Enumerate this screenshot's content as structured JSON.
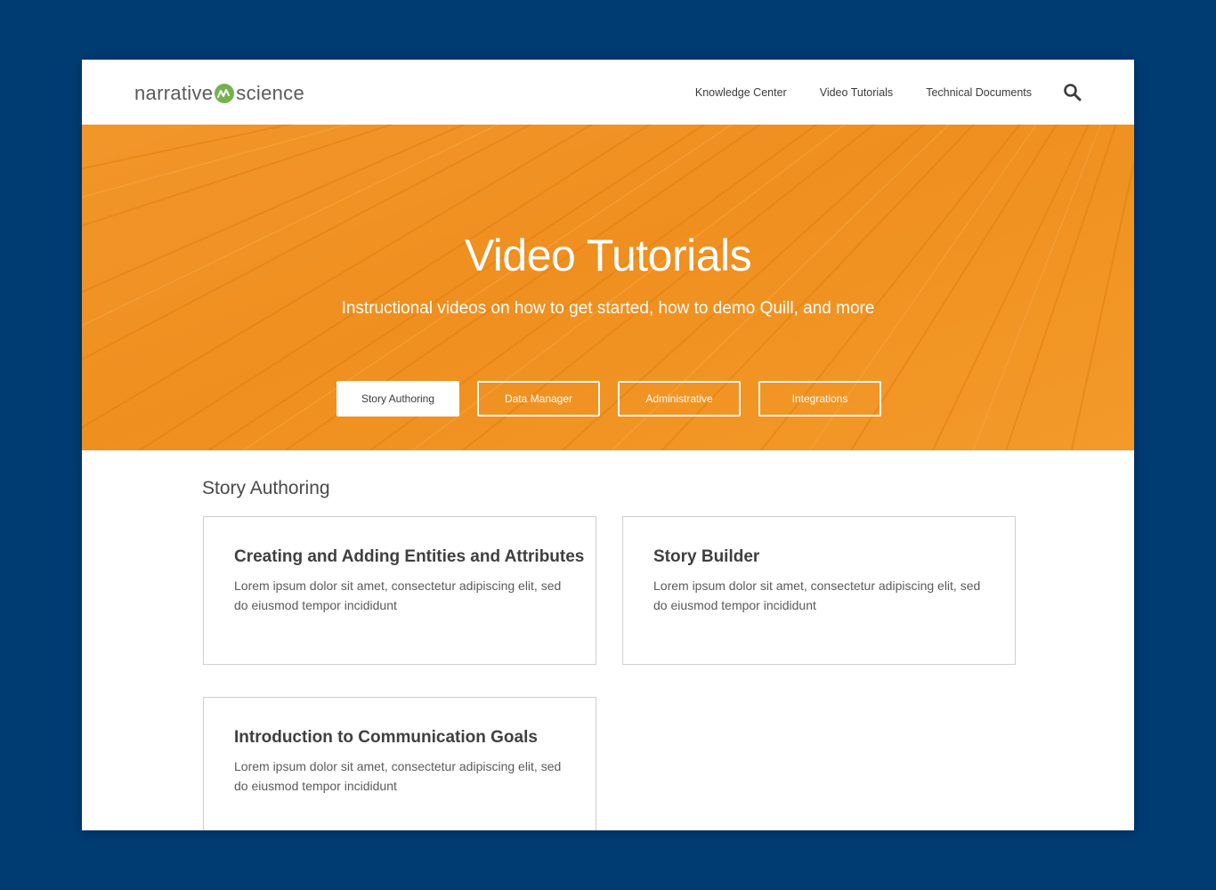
{
  "header": {
    "logo": {
      "left_text": "narrative",
      "mark_letter": "n",
      "right_text": "science"
    },
    "nav": [
      {
        "label": "Knowledge Center"
      },
      {
        "label": "Video Tutorials"
      },
      {
        "label": "Technical Documents"
      }
    ],
    "search_icon": "search-icon"
  },
  "hero": {
    "title": "Video Tutorials",
    "subtitle": "Instructional videos on how to get started, how to demo Quill, and more",
    "buttons": [
      {
        "label": "Story Authoring",
        "active": true
      },
      {
        "label": "Data Manager",
        "active": false
      },
      {
        "label": "Administrative",
        "active": false
      },
      {
        "label": "Integrations",
        "active": false
      }
    ]
  },
  "section": {
    "title": "Story Authoring",
    "cards": [
      {
        "title": "Creating and Adding Entities and Attributes",
        "description": "Lorem ipsum dolor sit amet, consectetur adipiscing elit, sed do eiusmod tempor incididunt"
      },
      {
        "title": "Story Builder",
        "description": "Lorem ipsum dolor sit amet, consectetur adipiscing elit, sed do eiusmod tempor incididunt"
      },
      {
        "title": "Introduction to Communication Goals",
        "description": "Lorem ipsum dolor sit amet, consectetur adipiscing elit, sed do eiusmod tempor incididunt"
      }
    ]
  },
  "colors": {
    "background": "#003b72",
    "hero_orange": "#f0921f",
    "logo_green": "#74b34c"
  }
}
